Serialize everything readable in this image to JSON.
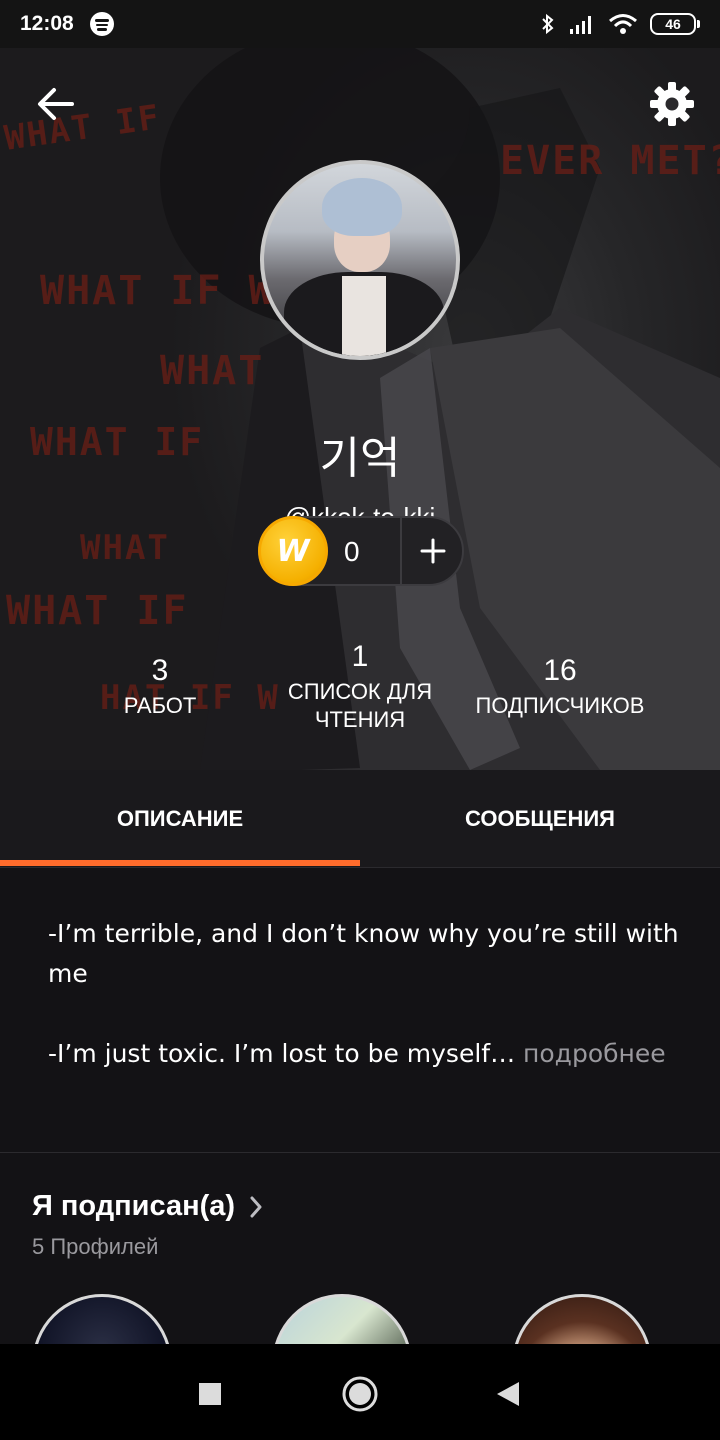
{
  "status_bar": {
    "time": "12:08",
    "battery": "46",
    "icons": [
      "spotify-icon",
      "bluetooth-icon",
      "signal-icon",
      "wifi-icon",
      "battery-icon"
    ]
  },
  "header": {
    "icons": {
      "back": "arrow-left-icon",
      "settings": "gear-icon"
    },
    "profile": {
      "display_name": "기억",
      "username": "@kkok-to-kki"
    },
    "coins": {
      "count": "0",
      "icon": "wattpad-coin-icon",
      "add_icon": "plus-icon"
    },
    "stats": [
      {
        "value": "3",
        "label_lines": [
          "РАБОТ"
        ]
      },
      {
        "value": "1",
        "label_lines": [
          "СПИСОК ДЛЯ",
          "ЧТЕНИЯ"
        ]
      },
      {
        "value": "16",
        "label_lines": [
          "ПОДПИСЧИКОВ"
        ]
      }
    ],
    "background_text": [
      "WHAT IF",
      "EVER MET?",
      "WHAT IF WE",
      "WHAT",
      "WHAT IF",
      "WHAT IF",
      "WHAT",
      "HAT IF W"
    ]
  },
  "tabs": [
    {
      "label": "ОПИСАНИЕ",
      "active": true
    },
    {
      "label": "СООБЩЕНИЯ",
      "active": false
    }
  ],
  "description": {
    "line1a": "-I’m terrible, and I don’t know why you’re still with",
    "line1b": "me",
    "line2": "-I’m just toxic. I’m lost to be myself…",
    "more": " подробнее"
  },
  "following": {
    "title": "Я подписан(а)",
    "subtitle": "5 Профилей",
    "chevron_icon": "chevron-right-icon"
  },
  "nav_bar": {
    "icons": [
      "square-recents-icon",
      "circle-home-icon",
      "triangle-back-icon"
    ]
  },
  "colors": {
    "accent": "#ff6c2c",
    "background": "#131215",
    "coin": "#f5b000"
  }
}
